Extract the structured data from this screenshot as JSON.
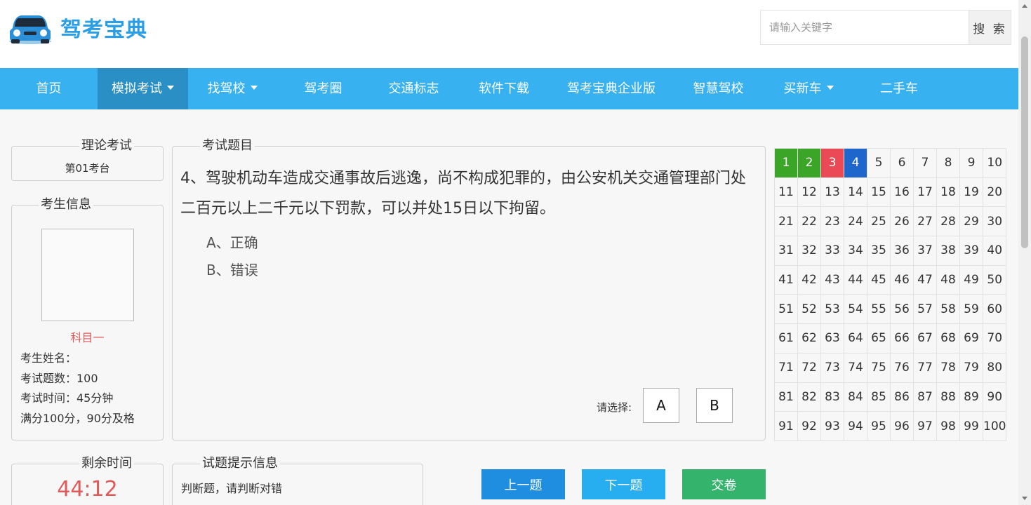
{
  "header": {
    "logo_text": "驾考宝典",
    "logo_icon": "blue-car-icon",
    "search": {
      "placeholder": "请输入关键字",
      "value": "",
      "button_label": "搜 索"
    }
  },
  "nav": {
    "items": [
      {
        "label": "首页",
        "active": false,
        "dropdown": false
      },
      {
        "label": "模拟考试",
        "active": true,
        "dropdown": true
      },
      {
        "label": "找驾校",
        "active": false,
        "dropdown": true
      },
      {
        "label": "驾考圈",
        "active": false,
        "dropdown": false
      },
      {
        "label": "交通标志",
        "active": false,
        "dropdown": false
      },
      {
        "label": "软件下载",
        "active": false,
        "dropdown": false
      },
      {
        "label": "驾考宝典企业版",
        "active": false,
        "dropdown": false
      },
      {
        "label": "智慧驾校",
        "active": false,
        "dropdown": false
      },
      {
        "label": "买新车",
        "active": false,
        "dropdown": true
      },
      {
        "label": "二手车",
        "active": false,
        "dropdown": false
      }
    ]
  },
  "exam_room": {
    "title": "理论考试",
    "room": "第01考台"
  },
  "examinee": {
    "title": "考生信息",
    "subject": "科目一",
    "name_line": "考生姓名：",
    "count_line": "考试题数：100",
    "time_line": "考试时间：45分钟",
    "score_line": "满分100分，90分及格"
  },
  "question": {
    "title": "考试题目",
    "text": "4、驾驶机动车造成交通事故后逃逸，尚不构成犯罪的，由公安机关交通管理部门处二百元以上二千元以下罚款，可以并处15日以下拘留。",
    "options": [
      "A、正确",
      "B、错误"
    ],
    "choose_label": "请选择:",
    "answer_buttons": [
      "A",
      "B"
    ]
  },
  "answer_grid": {
    "total": 100,
    "columns": 10,
    "done": [
      1,
      2
    ],
    "wrong": [
      3
    ],
    "current": 4
  },
  "remaining": {
    "title": "剩余时间",
    "time": "44:12"
  },
  "hint": {
    "title": "试题提示信息",
    "text": "判断题，请判断对错"
  },
  "actions": {
    "prev": "上一题",
    "next": "下一题",
    "submit": "交卷"
  },
  "colors": {
    "nav_bg": "#37b1f0",
    "nav_active": "#2a8fc4",
    "done": "#3aa526",
    "wrong": "#ea4a55",
    "current": "#1e66cc",
    "timer": "#e05a5a",
    "prev_btn": "#1f8ee0",
    "next_btn": "#27aef0",
    "submit_btn": "#33b36b"
  }
}
